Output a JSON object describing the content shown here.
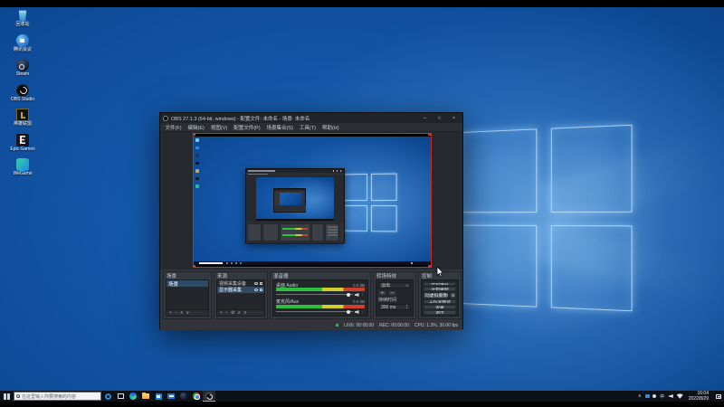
{
  "desktop": {
    "icons": [
      {
        "label": "回收站"
      },
      {
        "label": "腾讯会议"
      },
      {
        "label": "Steam"
      },
      {
        "label": "OBS Studio"
      },
      {
        "label": "英雄联盟"
      },
      {
        "label": "Epic Games"
      },
      {
        "label": "WeGame"
      }
    ]
  },
  "obs": {
    "window_title": "OBS 27.1.3 (64-bit, windows) - 配置文件: 未命名 - 场景: 未命名",
    "menus": [
      "文件(F)",
      "编辑(E)",
      "视图(V)",
      "配置文件(P)",
      "场景集合(S)",
      "工具(T)",
      "帮助(H)"
    ],
    "scenes": {
      "title": "场景",
      "items": [
        {
          "name": "场景"
        }
      ]
    },
    "sources": {
      "title": "来源",
      "items": [
        {
          "name": "视频采集设备"
        },
        {
          "name": "显示器采集"
        }
      ]
    },
    "mixer": {
      "title": "混音器",
      "channels": [
        {
          "name": "桌面 Audio",
          "db": "0.0 dB"
        },
        {
          "name": "麦克风/Aux",
          "db": "0.0 dB"
        }
      ]
    },
    "transitions": {
      "title": "转场特效",
      "selected": "淡出",
      "duration_label": "持续时间",
      "duration_value": "300 ms"
    },
    "controls": {
      "title": "控制",
      "stream": "开始推流",
      "record": "开始录制",
      "virtualcam": "启动虚拟摄像机",
      "studio": "工作室模式",
      "settings": "设置",
      "exit": "退出"
    },
    "status": {
      "live": "LIVE: 00:00:00",
      "rec": "REC: 00:00:00",
      "cpu": "CPU: 1.3%, 30.00 fps"
    }
  },
  "taskbar": {
    "search_placeholder": "在这里输入你要搜索的内容",
    "tray": {
      "ime": "中",
      "time": "16:04",
      "date": "2022/8/29"
    }
  },
  "icons": {
    "minimize": "─",
    "maximize": "□",
    "close": "×",
    "add": "+",
    "remove": "−",
    "up": "∧",
    "down": "∨",
    "gear": "⚙",
    "more": "⋮",
    "dropdown": "∨",
    "spin_up": "▲",
    "spin_down": "▼",
    "tray_caret": "∧"
  }
}
